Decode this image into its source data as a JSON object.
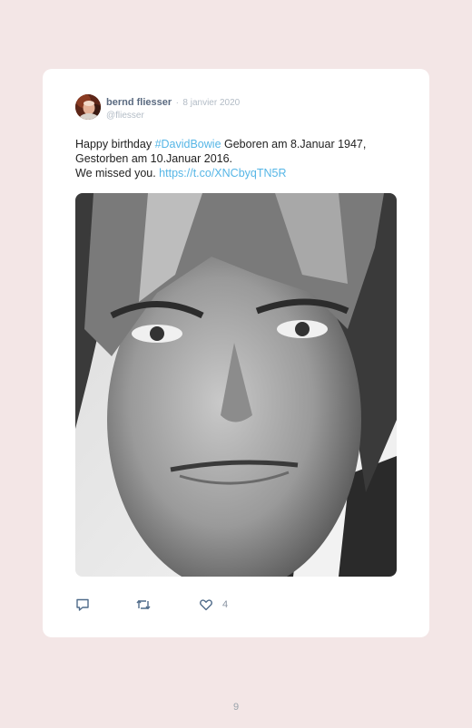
{
  "tweet": {
    "author_name": "bernd fliesser",
    "separator": "·",
    "date": "8 janvier 2020",
    "handle": "@fliesser",
    "text_1": "Happy birthday ",
    "hashtag": "#DavidBowie",
    "text_2": " Geboren am 8.Januar 1947, Gestorben am 10.Januar 2016.",
    "text_3": "We missed you. ",
    "url": "https://t.co/XNCbyqTN5R",
    "like_count": "4"
  },
  "actions": {
    "reply_icon": "speech-bubble-icon",
    "retweet_icon": "retweet-icon",
    "like_icon": "heart-icon"
  },
  "colors": {
    "page_background": "#f3e6e6",
    "card_background": "#ffffff",
    "link": "#56b6e6",
    "author_name": "#5a6a80"
  },
  "footer": {
    "page_number": "9"
  }
}
